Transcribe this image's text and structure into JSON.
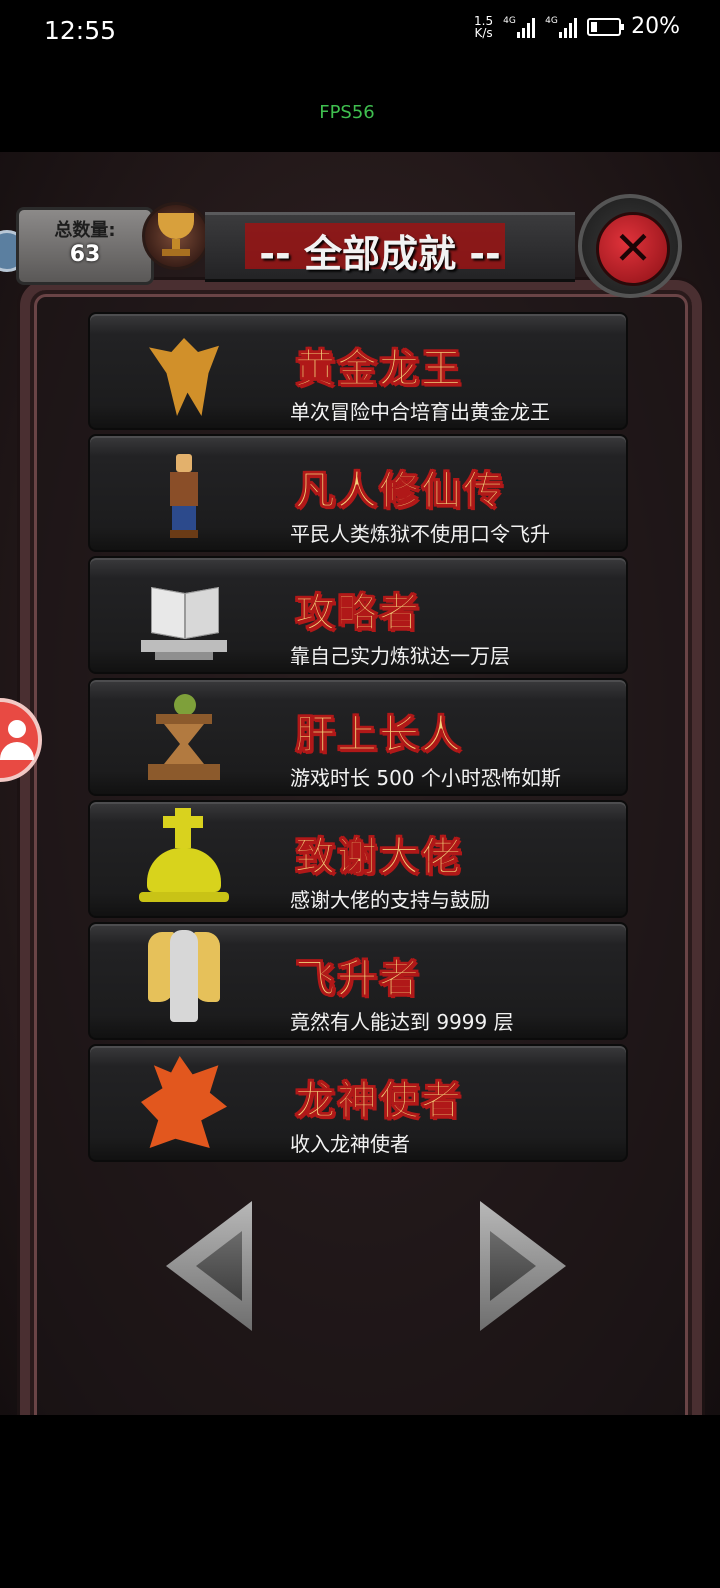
{
  "status_bar": {
    "time": "12:55",
    "net_speed_value": "1.5",
    "net_speed_unit": "K/s",
    "signal1_label": "4G",
    "signal2_label": "4G",
    "battery_percent": "20%",
    "battery_level": 0.2
  },
  "fps_label": "FPS56",
  "header": {
    "counter_label": "总数量:",
    "counter_value": "63",
    "title": "-- 全部成就 --",
    "close_glyph": "✕"
  },
  "achievements": [
    {
      "name": "黄金龙王",
      "desc": "单次冒险中合培育出黄金龙王",
      "icon": "gold-dragon-icon"
    },
    {
      "name": "凡人修仙传",
      "desc": "平民人类炼狱不使用口令飞升",
      "icon": "human-icon"
    },
    {
      "name": "攻略者",
      "desc": "靠自己实力炼狱达一万层",
      "icon": "book-icon"
    },
    {
      "name": "肝上长人",
      "desc": "游戏时长 500 个小时恐怖如斯",
      "icon": "hourglass-icon"
    },
    {
      "name": "致谢大佬",
      "desc": "感谢大佬的支持与鼓励",
      "icon": "golden-statue-icon"
    },
    {
      "name": "飞升者",
      "desc": "竟然有人能达到 9999 层",
      "icon": "angel-icon"
    },
    {
      "name": "龙神使者",
      "desc": "收入龙神使者",
      "icon": "red-dragon-icon"
    }
  ],
  "colors": {
    "title_red": "#b01818",
    "name_gold": "#f3d27a",
    "fps_green": "#3fbf4f",
    "close_red": "#e0333b"
  }
}
